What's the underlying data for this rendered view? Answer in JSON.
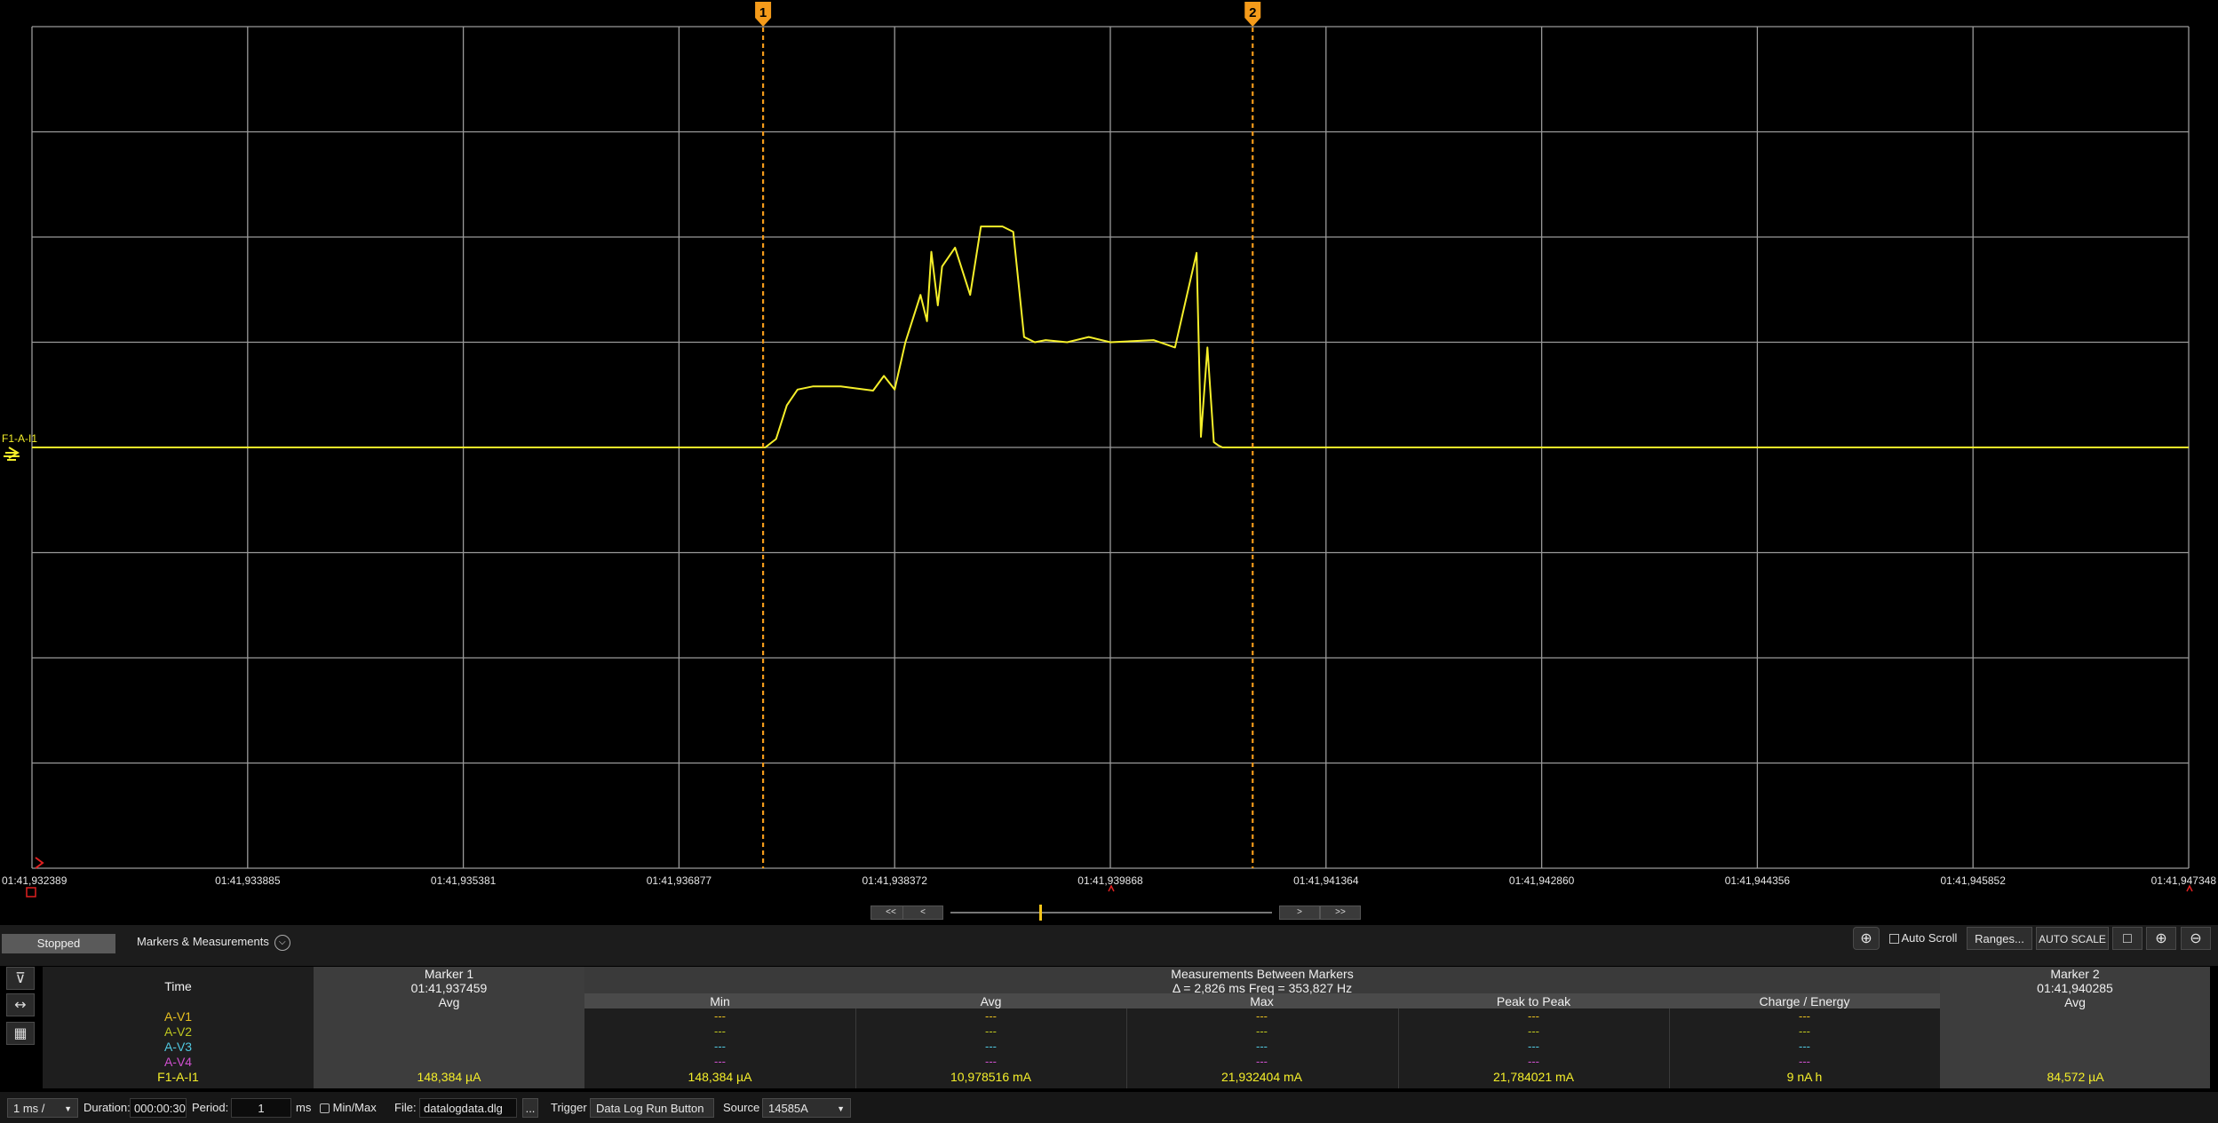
{
  "app": {
    "status": "Stopped",
    "markers_measurements_label": "Markers & Measurements",
    "toolbar": {
      "auto_scroll_label": "Auto Scroll",
      "ranges_label": "Ranges...",
      "auto_scale_label": "AUTO SCALE"
    },
    "nav": {
      "first_label": "<<",
      "prev_label": "<",
      "next_label": ">",
      "last_label": ">>"
    }
  },
  "plot": {
    "channel_tag": "F1-A-I1",
    "x_ticks": [
      "01:41,932389",
      "01:41,933885",
      "01:41,935381",
      "01:41,936877",
      "01:41,938372",
      "01:41,939868",
      "01:41,941364",
      "01:41,942860",
      "01:41,944356",
      "01:41,945852",
      "01:41,947348"
    ],
    "marker1_label": "1",
    "marker2_label": "2",
    "colors": {
      "trace": "#f5ef2a",
      "marker": "#f59b1a",
      "grid": "#9a9a9a",
      "background": "#000000"
    }
  },
  "chart_data": {
    "type": "line",
    "title": "",
    "xlabel": "",
    "ylabel": "",
    "grid": true,
    "series": [
      {
        "name": "F1-A-I1",
        "x": [
          0,
          3.4,
          3.45,
          3.5,
          3.55,
          3.62,
          3.75,
          3.9,
          3.95,
          4.0,
          4.05,
          4.12,
          4.15,
          4.17,
          4.2,
          4.22,
          4.28,
          4.35,
          4.4,
          4.5,
          4.55,
          4.6,
          4.65,
          4.7,
          4.8,
          4.9,
          5.0,
          5.2,
          5.3,
          5.4,
          5.42,
          5.45,
          5.48,
          5.5,
          5.52,
          5.56,
          10.0
        ],
        "y": [
          0,
          0,
          0.08,
          0.4,
          0.55,
          0.58,
          0.58,
          0.54,
          0.68,
          0.55,
          1.0,
          1.45,
          1.2,
          1.86,
          1.35,
          1.72,
          1.9,
          1.45,
          2.1,
          2.1,
          2.05,
          1.05,
          1.0,
          1.02,
          1.0,
          1.05,
          1.0,
          1.02,
          0.95,
          1.85,
          0.1,
          0.95,
          0.05,
          0.02,
          0.0,
          0.0,
          0.0
        ]
      }
    ]
  },
  "measurements": {
    "marker1": {
      "header": "Marker 1",
      "time": "01:41,937459",
      "sub": "Avg",
      "value": "148,384 µA"
    },
    "between": {
      "header": "Measurements Between Markers",
      "delta": "Δ = 2,826 ms   Freq = 353,827 Hz",
      "columns": [
        "Min",
        "Avg",
        "Max",
        "Peak to Peak",
        "Charge / Energy"
      ],
      "values": [
        "148,384 µA",
        "10,978516 mA",
        "21,932404 mA",
        "21,784021 mA",
        "9 nA h"
      ],
      "dash": "---"
    },
    "marker2": {
      "header": "Marker 2",
      "time": "01:41,940285",
      "sub": "Avg",
      "value": "84,572 µA"
    },
    "time_label": "Time",
    "rows": [
      "A-V1",
      "A-V2",
      "A-V3",
      "A-V4",
      "F1-A-I1"
    ],
    "row_colors": [
      "#e8c020",
      "#c0c820",
      "#50c8e0",
      "#d050d0",
      "#f5ef2a"
    ]
  },
  "bottom": {
    "timebase": "1 ms /",
    "duration_label": "Duration:",
    "duration_value": "000:00:30",
    "period_label": "Period:",
    "period_value": "1",
    "period_unit": "ms",
    "minmax_label": "Min/Max",
    "file_label": "File:",
    "file_value": "datalogdata.dlg",
    "file_button": "...",
    "trigger_label": "Trigger",
    "trigger_value": "Data Log Run Button",
    "source_label": "Source",
    "source_value": "14585A"
  }
}
